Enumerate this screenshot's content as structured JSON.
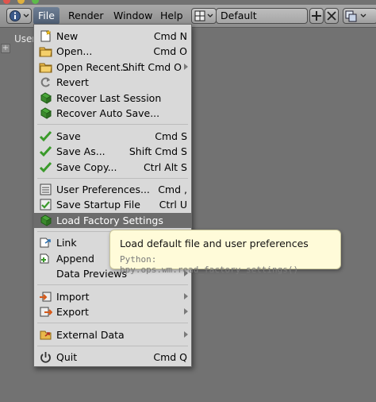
{
  "header": {
    "menus": [
      "File",
      "Render",
      "Window",
      "Help"
    ],
    "layout_name": "Default"
  },
  "left_area": {
    "user_label": "User"
  },
  "file_menu": {
    "items": [
      {
        "label": "New",
        "shortcut": "Cmd N",
        "icon": "new-file-icon"
      },
      {
        "label": "Open...",
        "shortcut": "Cmd O",
        "icon": "folder-icon"
      },
      {
        "label": "Open Recent...",
        "shortcut": "Shift Cmd O",
        "icon": "folder-recent-icon"
      },
      {
        "label": "Revert",
        "shortcut": "",
        "icon": "revert-icon"
      },
      {
        "label": "Recover Last Session",
        "shortcut": "",
        "icon": "recover-icon"
      },
      {
        "label": "Recover Auto Save...",
        "shortcut": "",
        "icon": "recover-auto-icon"
      },
      {
        "label": "Save",
        "shortcut": "Cmd S",
        "icon": "checkmark-icon"
      },
      {
        "label": "Save As...",
        "shortcut": "Shift Cmd S",
        "icon": "checkmark-icon"
      },
      {
        "label": "Save Copy...",
        "shortcut": "Ctrl Alt S",
        "icon": "checkmark-icon"
      },
      {
        "label": "User Preferences...",
        "shortcut": "Cmd ,",
        "icon": "preferences-icon"
      },
      {
        "label": "Save Startup File",
        "shortcut": "Ctrl U",
        "icon": "save-startup-icon"
      },
      {
        "label": "Load Factory Settings",
        "shortcut": "",
        "icon": "load-factory-icon"
      },
      {
        "label": "Link",
        "shortcut": "",
        "icon": "link-icon"
      },
      {
        "label": "Append",
        "shortcut": "",
        "icon": "append-icon"
      },
      {
        "label": "Data Previews",
        "shortcut": "",
        "icon": ""
      },
      {
        "label": "Import",
        "shortcut": "",
        "icon": "import-icon"
      },
      {
        "label": "Export",
        "shortcut": "",
        "icon": "export-icon"
      },
      {
        "label": "External Data",
        "shortcut": "",
        "icon": "external-data-icon"
      },
      {
        "label": "Quit",
        "shortcut": "Cmd Q",
        "icon": "power-icon"
      }
    ]
  },
  "tooltip": {
    "title": "Load default file and user preferences",
    "python": "Python: bpy.ops.wm.read_factory_settings()"
  },
  "colors": {
    "menu_bg": "#d9d9d9",
    "highlight": "#6c6c6c",
    "tooltip_bg": "#fffbd9",
    "active_menu": "#5a6a80",
    "check_green": "#3a9a2a"
  }
}
